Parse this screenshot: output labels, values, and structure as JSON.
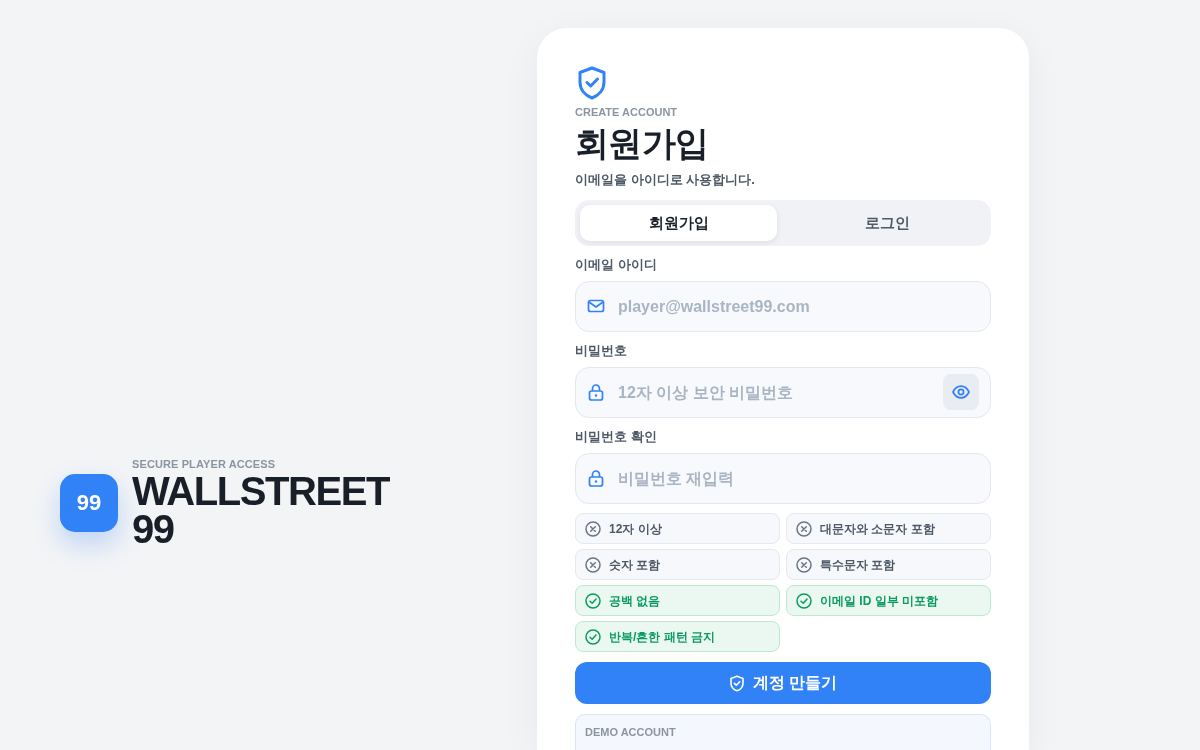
{
  "brand": {
    "logo_text": "99",
    "eyebrow": "SECURE PLAYER ACCESS",
    "name": "WALLSTREET 99"
  },
  "form": {
    "eyebrow": "CREATE ACCOUNT",
    "title": "회원가입",
    "subtitle": "이메일을 아이디로 사용합니다.",
    "tabs": [
      {
        "label": "회원가입",
        "selected": true
      },
      {
        "label": "로그인",
        "selected": false
      }
    ],
    "fields": [
      {
        "kind": "email",
        "label": "이메일 아이디",
        "placeholder": "player@wallstreet99.com",
        "reveal_button": false
      },
      {
        "kind": "password",
        "label": "비밀번호",
        "placeholder": "12자 이상 보안 비밀번호",
        "reveal_button": true
      },
      {
        "kind": "password",
        "label": "비밀번호 확인",
        "placeholder": "비밀번호 재입력",
        "reveal_button": false
      }
    ],
    "requirements": [
      {
        "label": "12자 이상",
        "met": false
      },
      {
        "label": "대문자와 소문자 포함",
        "met": false
      },
      {
        "label": "숫자 포함",
        "met": false
      },
      {
        "label": "특수문자 포함",
        "met": false
      },
      {
        "label": "공백 없음",
        "met": true
      },
      {
        "label": "이메일 ID 일부 미포함",
        "met": true
      },
      {
        "label": "반복/흔한 패턴 금지",
        "met": true
      }
    ],
    "submit_button": "계정 만들기",
    "demo_account": {
      "title": "DEMO ACCOUNT"
    }
  }
}
